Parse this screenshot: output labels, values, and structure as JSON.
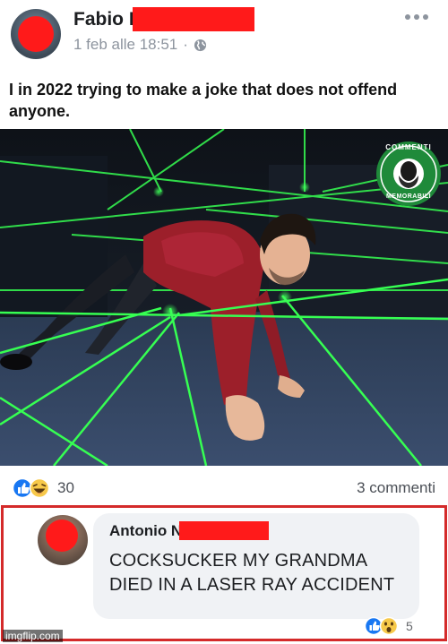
{
  "post": {
    "author": "Fabio F",
    "date": "1 feb alle 18:51",
    "separator": "·",
    "text": "I in 2022 trying to make a joke that does not offend anyone."
  },
  "image": {
    "badge_top": "COMMENTI",
    "badge_bottom": "MEMORABILI",
    "laser_color": "#36ff52"
  },
  "reactions": {
    "count": "30",
    "comments": "3 commenti",
    "types": [
      "like-icon",
      "laugh-icon"
    ]
  },
  "comment": {
    "author": "Antonio N",
    "text": "COCKSUCKER MY GRANDMA DIED IN A LASER RAY ACCIDENT",
    "reaction_count": "5",
    "reaction_types": [
      "like-icon",
      "wow-icon"
    ]
  },
  "watermark": "imgflip.com",
  "colors": {
    "redaction": "#ff1a1a",
    "highlight_border": "#d42a2a",
    "like_blue": "#1877f2",
    "reaction_yellow": "#f7c94a"
  }
}
